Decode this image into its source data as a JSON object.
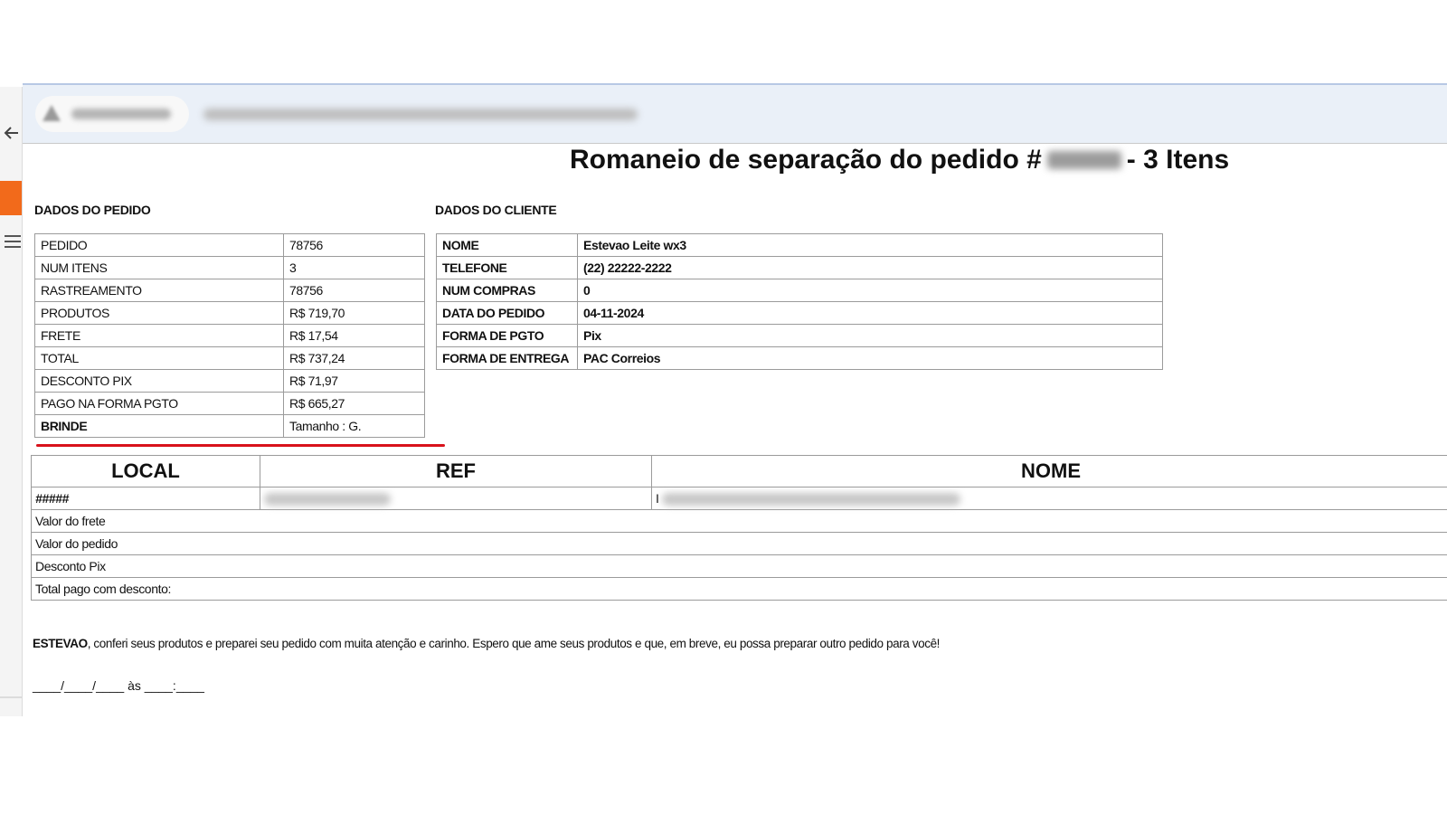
{
  "document": {
    "title_prefix": "Romaneio de separação do pedido #",
    "title_suffix": "- 3 Itens"
  },
  "pedido": {
    "label": "DADOS DO PEDIDO",
    "rows": [
      {
        "k": "PEDIDO",
        "v": "78756"
      },
      {
        "k": "NUM ITENS",
        "v": "3"
      },
      {
        "k": "RASTREAMENTO",
        "v": "78756"
      },
      {
        "k": "PRODUTOS",
        "v": "R$ 719,70"
      },
      {
        "k": "FRETE",
        "v": "R$ 17,54"
      },
      {
        "k": "TOTAL",
        "v": "R$ 737,24"
      },
      {
        "k": "DESCONTO PIX",
        "v": "R$ 71,97"
      },
      {
        "k": "PAGO NA FORMA PGTO",
        "v": "R$ 665,27"
      },
      {
        "k": "BRINDE",
        "v": "Tamanho : G."
      }
    ]
  },
  "cliente": {
    "label": "DADOS DO CLIENTE",
    "rows": [
      {
        "k": "NOME",
        "v": "Estevao Leite wx3"
      },
      {
        "k": "TELEFONE",
        "v": "(22) 22222-2222"
      },
      {
        "k": "NUM COMPRAS",
        "v": "0"
      },
      {
        "k": "DATA DO PEDIDO",
        "v": "04-11-2024"
      },
      {
        "k": "FORMA DE PGTO",
        "v": "Pix"
      },
      {
        "k": "FORMA DE ENTREGA",
        "v": "PAC Correios"
      }
    ]
  },
  "items": {
    "headers": [
      "LOCAL",
      "REF",
      "NOME"
    ],
    "row_local": "#####",
    "row_nome_prefix": "I",
    "summary": [
      "Valor do frete",
      "Valor do pedido",
      "Desconto Pix",
      "Total pago com desconto:"
    ]
  },
  "message": {
    "name": "ESTEVAO",
    "text": ", conferi seus produtos e preparei seu pedido com muita atenção e carinho. Espero que ame seus produtos e que, em breve, eu possa preparar outro pedido para você!"
  },
  "signature": {
    "line": "____/____/____ às ____:____"
  },
  "colors": {
    "accent_orange": "#f26a1b",
    "highlight_red": "#d8121b",
    "header_bar": "#eaf0f8"
  }
}
